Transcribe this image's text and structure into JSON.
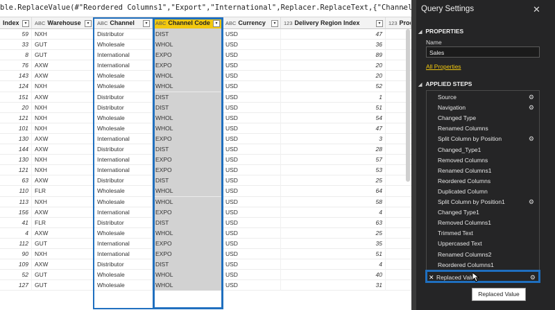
{
  "formula": "ble.ReplaceValue(#\"Reordered Columns1\",\"Export\",\"International\",Replacer.ReplaceText,{\"Channel\"})",
  "formula_expand": "⌄",
  "columns": [
    {
      "type": "",
      "name": "Index"
    },
    {
      "type": "ABC",
      "name": "Warehouse"
    },
    {
      "type": "ABC",
      "name": "Channel"
    },
    {
      "type": "ABC",
      "name": "Channel Code"
    },
    {
      "type": "ABC",
      "name": "Currency"
    },
    {
      "type": "123",
      "name": "Delivery Region Index"
    },
    {
      "type": "123",
      "name": "Product"
    }
  ],
  "rows": [
    [
      "59",
      "NXH",
      "Distributor",
      "DIST",
      "USD",
      "47"
    ],
    [
      "33",
      "GUT",
      "Wholesale",
      "WHOL",
      "USD",
      "36"
    ],
    [
      "8",
      "GUT",
      "International",
      "EXPO",
      "USD",
      "89"
    ],
    [
      "76",
      "AXW",
      "International",
      "EXPO",
      "USD",
      "20"
    ],
    [
      "143",
      "AXW",
      "Wholesale",
      "WHOL",
      "USD",
      "20"
    ],
    [
      "124",
      "NXH",
      "Wholesale",
      "WHOL",
      "USD",
      "52"
    ],
    [
      "151",
      "AXW",
      "Distributor",
      "DIST",
      "USD",
      "1"
    ],
    [
      "20",
      "NXH",
      "Distributor",
      "DIST",
      "USD",
      "51"
    ],
    [
      "121",
      "NXH",
      "Wholesale",
      "WHOL",
      "USD",
      "54"
    ],
    [
      "101",
      "NXH",
      "Wholesale",
      "WHOL",
      "USD",
      "47"
    ],
    [
      "130",
      "AXW",
      "International",
      "EXPO",
      "USD",
      "3"
    ],
    [
      "144",
      "AXW",
      "Distributor",
      "DIST",
      "USD",
      "28"
    ],
    [
      "130",
      "NXH",
      "International",
      "EXPO",
      "USD",
      "57"
    ],
    [
      "121",
      "NXH",
      "International",
      "EXPO",
      "USD",
      "53"
    ],
    [
      "63",
      "AXW",
      "Distributor",
      "DIST",
      "USD",
      "25"
    ],
    [
      "110",
      "FLR",
      "Wholesale",
      "WHOL",
      "USD",
      "64"
    ],
    [
      "113",
      "NXH",
      "Wholesale",
      "WHOL",
      "USD",
      "58"
    ],
    [
      "156",
      "AXW",
      "International",
      "EXPO",
      "USD",
      "4"
    ],
    [
      "41",
      "FLR",
      "Distributor",
      "DIST",
      "USD",
      "63"
    ],
    [
      "4",
      "AXW",
      "Wholesale",
      "WHOL",
      "USD",
      "25"
    ],
    [
      "112",
      "GUT",
      "International",
      "EXPO",
      "USD",
      "35"
    ],
    [
      "90",
      "NXH",
      "International",
      "EXPO",
      "USD",
      "51"
    ],
    [
      "109",
      "AXW",
      "Distributor",
      "DIST",
      "USD",
      "4"
    ],
    [
      "52",
      "GUT",
      "Wholesale",
      "WHOL",
      "USD",
      "40"
    ],
    [
      "127",
      "GUT",
      "Wholesale",
      "WHOL",
      "USD",
      "31"
    ]
  ],
  "panel": {
    "title": "Query Settings",
    "close": "✕",
    "properties_header": "PROPERTIES",
    "name_label": "Name",
    "name_value": "Sales",
    "all_properties": "All Properties",
    "applied_steps_header": "APPLIED STEPS",
    "tooltip": "Replaced Value"
  },
  "steps": [
    {
      "label": "Source",
      "gear": true
    },
    {
      "label": "Navigation",
      "gear": true
    },
    {
      "label": "Changed Type",
      "gear": false
    },
    {
      "label": "Renamed Columns",
      "gear": false
    },
    {
      "label": "Split Column by Position",
      "gear": true
    },
    {
      "label": "Changed_Type1",
      "gear": false
    },
    {
      "label": "Removed Columns",
      "gear": false
    },
    {
      "label": "Renamed Columns1",
      "gear": false
    },
    {
      "label": "Reordered Columns",
      "gear": false
    },
    {
      "label": "Duplicated Column",
      "gear": false
    },
    {
      "label": "Split Column by Position1",
      "gear": true
    },
    {
      "label": "Changed Type1",
      "gear": false
    },
    {
      "label": "Removed Columns1",
      "gear": false
    },
    {
      "label": "Trimmed Text",
      "gear": false
    },
    {
      "label": "Uppercased Text",
      "gear": false
    },
    {
      "label": "Renamed Columns2",
      "gear": false
    },
    {
      "label": "Reordered Columns1",
      "gear": false
    },
    {
      "label": "Replaced Value",
      "gear": true,
      "active": true
    }
  ],
  "colors": {
    "accent": "#f2c80f",
    "selection": "#1f6fbf",
    "panel_bg": "#252526"
  }
}
